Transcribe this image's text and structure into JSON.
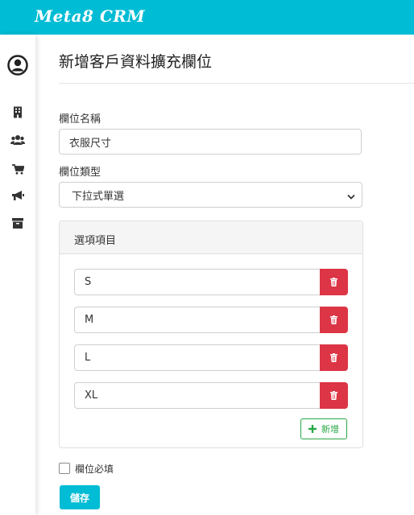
{
  "app": {
    "brand": "Meta8 CRM"
  },
  "sidebar": {
    "items": [
      {
        "icon": "user-circle-icon"
      },
      {
        "icon": "building-icon"
      },
      {
        "icon": "users-icon"
      },
      {
        "icon": "cart-icon"
      },
      {
        "icon": "megaphone-icon"
      },
      {
        "icon": "archive-icon"
      }
    ]
  },
  "page": {
    "title": "新增客戶資料擴充欄位"
  },
  "form": {
    "field_name_label": "欄位名稱",
    "field_name_value": "衣服尺寸",
    "field_type_label": "欄位類型",
    "field_type_value": "下拉式單選",
    "options_card_title": "選項項目",
    "options": [
      "S",
      "M",
      "L",
      "XL"
    ],
    "add_label": "新增",
    "required_label": "欄位必填",
    "required_checked": false,
    "save_label": "儲存"
  },
  "colors": {
    "accent": "#00bcd4",
    "danger": "#dc3545",
    "success": "#28a745"
  }
}
